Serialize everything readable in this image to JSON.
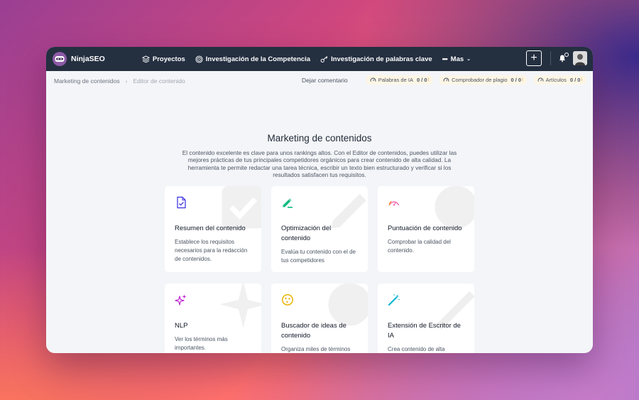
{
  "app": {
    "brand": "NinjaSEO"
  },
  "nav": [
    {
      "label": "Proyectos",
      "icon": "layers-icon"
    },
    {
      "label": "Investigación de la Competencia",
      "icon": "target-icon"
    },
    {
      "label": "Investigación de palabras clave",
      "icon": "key-icon"
    },
    {
      "label": "Mas",
      "icon": "more-dots-icon"
    }
  ],
  "breadcrumb": {
    "parent": "Marketing de contenidos",
    "separator": "›",
    "current": "Editor de contenido"
  },
  "toolbar": {
    "comment": "Dejar comentario",
    "badges": [
      {
        "label": "Palabras de IA",
        "count": "0 / 0",
        "icon": "gauge-icon"
      },
      {
        "label": "Comprobador de plagio",
        "count": "0 / 0",
        "icon": "gauge-icon"
      },
      {
        "label": "Artículos",
        "count": "0 / 0",
        "icon": "gauge-icon"
      }
    ]
  },
  "hero": {
    "title": "Marketing de contenidos",
    "description": "El contenido excelente es clave para unos rankings altos. Con el Editor de contenidos, puedes utilizar las mejores prácticas de tus principales competidores orgánicos para crear contenido de alta calidad. La herramienta te permite redactar una tarea técnica, escribir un texto bien estructurado y verificar si los resultados satisfacen tus requisitos."
  },
  "cards": [
    {
      "title": "Resumen del contenido",
      "description": "Establece los requisitos necesarios para la redacción de contenidos.",
      "icon": "document-check-icon",
      "color": "#4f46e5"
    },
    {
      "title": "Optimización del contenido",
      "description": "Evalúa tu contenido con el de tus competidores",
      "icon": "pencil-icon",
      "color": "#10b981"
    },
    {
      "title": "Puntuación de contenido",
      "description": "Comprobar la calidad del contenido.",
      "icon": "speedometer-icon",
      "color": "#f472b6"
    },
    {
      "title": "NLP",
      "description": "Ver los términos más importantes.",
      "icon": "sparkles-icon",
      "color": "#c026d3"
    },
    {
      "title": "Buscador de ideas de contenido",
      "description": "Organiza miles de términos",
      "icon": "cookie-icon",
      "color": "#eab308"
    },
    {
      "title": "Extensión de Escritor de IA",
      "description": "Crea contenido de alta",
      "icon": "magic-wand-icon",
      "color": "#06b6d4"
    }
  ]
}
